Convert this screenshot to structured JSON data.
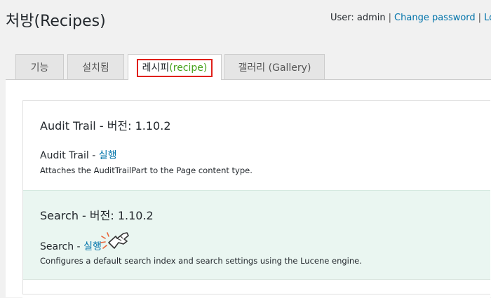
{
  "page": {
    "title": "처방(Recipes)"
  },
  "user_bar": {
    "user_label": "User: admin",
    "separator": "|",
    "change_password": "Change password",
    "logout": "Log"
  },
  "tabs": [
    {
      "label": "기능"
    },
    {
      "label": "설치됨"
    },
    {
      "label_main": "레시피",
      "label_paren": "(recipe)",
      "active": true
    },
    {
      "label": "갤러리 (Gallery)"
    }
  ],
  "recipes": [
    {
      "title": "Audit Trail - 버전: 1.10.2",
      "run_prefix": "Audit Trail - ",
      "run_label": "실행",
      "description": "Attaches the AuditTrailPart to the Page content type."
    },
    {
      "title": "Search - 버전: 1.10.2",
      "run_prefix": "Search - ",
      "run_label": "실행",
      "description": "Configures a default search index and search settings using the Lucene engine."
    }
  ],
  "colors": {
    "highlight_border": "#e0201a",
    "paren_text": "#46a21c",
    "link": "#0073aa",
    "hover_row": "#eaf6f1",
    "pointer_burst": "#e8643a"
  },
  "icons": {
    "pointer": "pointing-hand-cursor-icon"
  }
}
